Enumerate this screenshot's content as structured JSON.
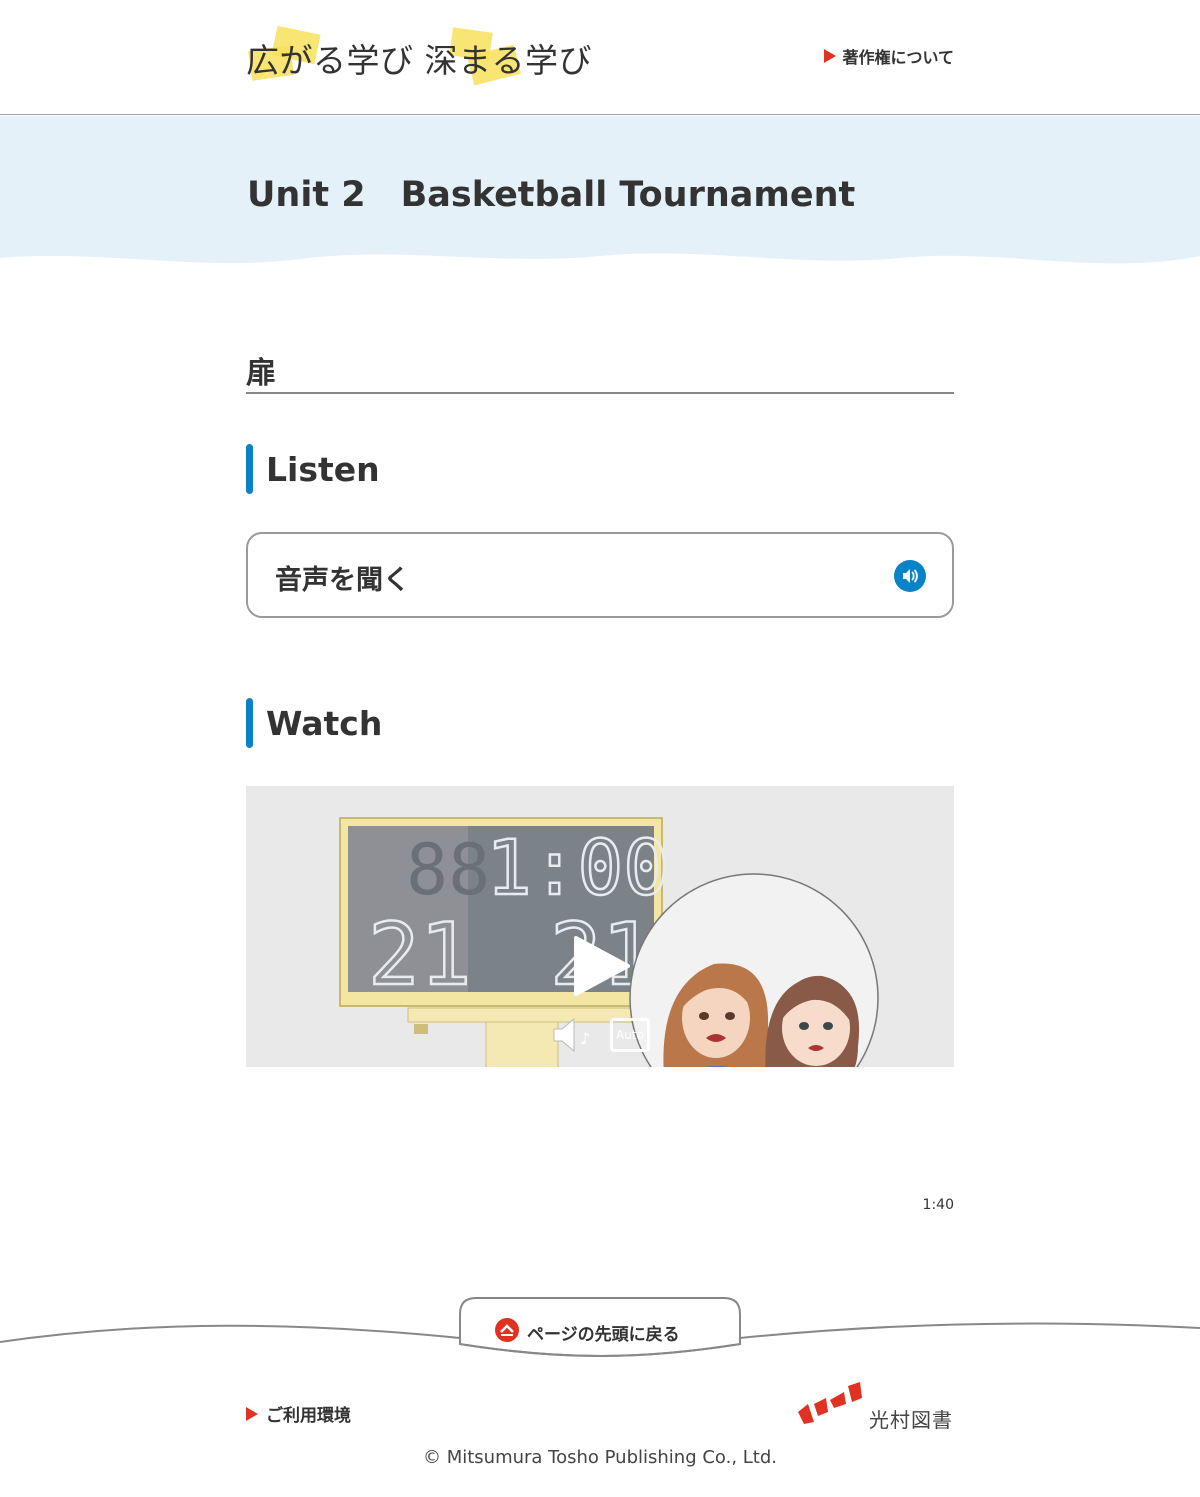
{
  "header": {
    "logo_text": "広がる学び 深まる学び",
    "copyright_link": "著作権について"
  },
  "hero": {
    "title": "Unit 2　Basketball Tournament"
  },
  "section": {
    "title": "扉"
  },
  "listen": {
    "heading": "Listen",
    "button_label": "音声を聞く"
  },
  "watch": {
    "heading": "Watch",
    "scoreboard_time": "1:00",
    "score_left": "21",
    "score_right": "21",
    "caption_badge": "Auto",
    "duration": "1:40"
  },
  "footer": {
    "back_to_top": "ページの先頭に戻る",
    "environment_link": "ご利用環境",
    "publisher_name": "光村図書",
    "copyright": "© Mitsumura Tosho Publishing Co., Ltd."
  },
  "colors": {
    "accent_blue": "#0a82c8",
    "accent_red": "#e03222",
    "highlight_yellow": "#f7e15a",
    "hero_bg": "#e4f1f9"
  },
  "icons": {
    "speaker": "speaker-icon",
    "play": "play-icon",
    "volume": "volume-icon",
    "caption": "caption-icon",
    "up_arrow": "up-arrow-icon"
  }
}
